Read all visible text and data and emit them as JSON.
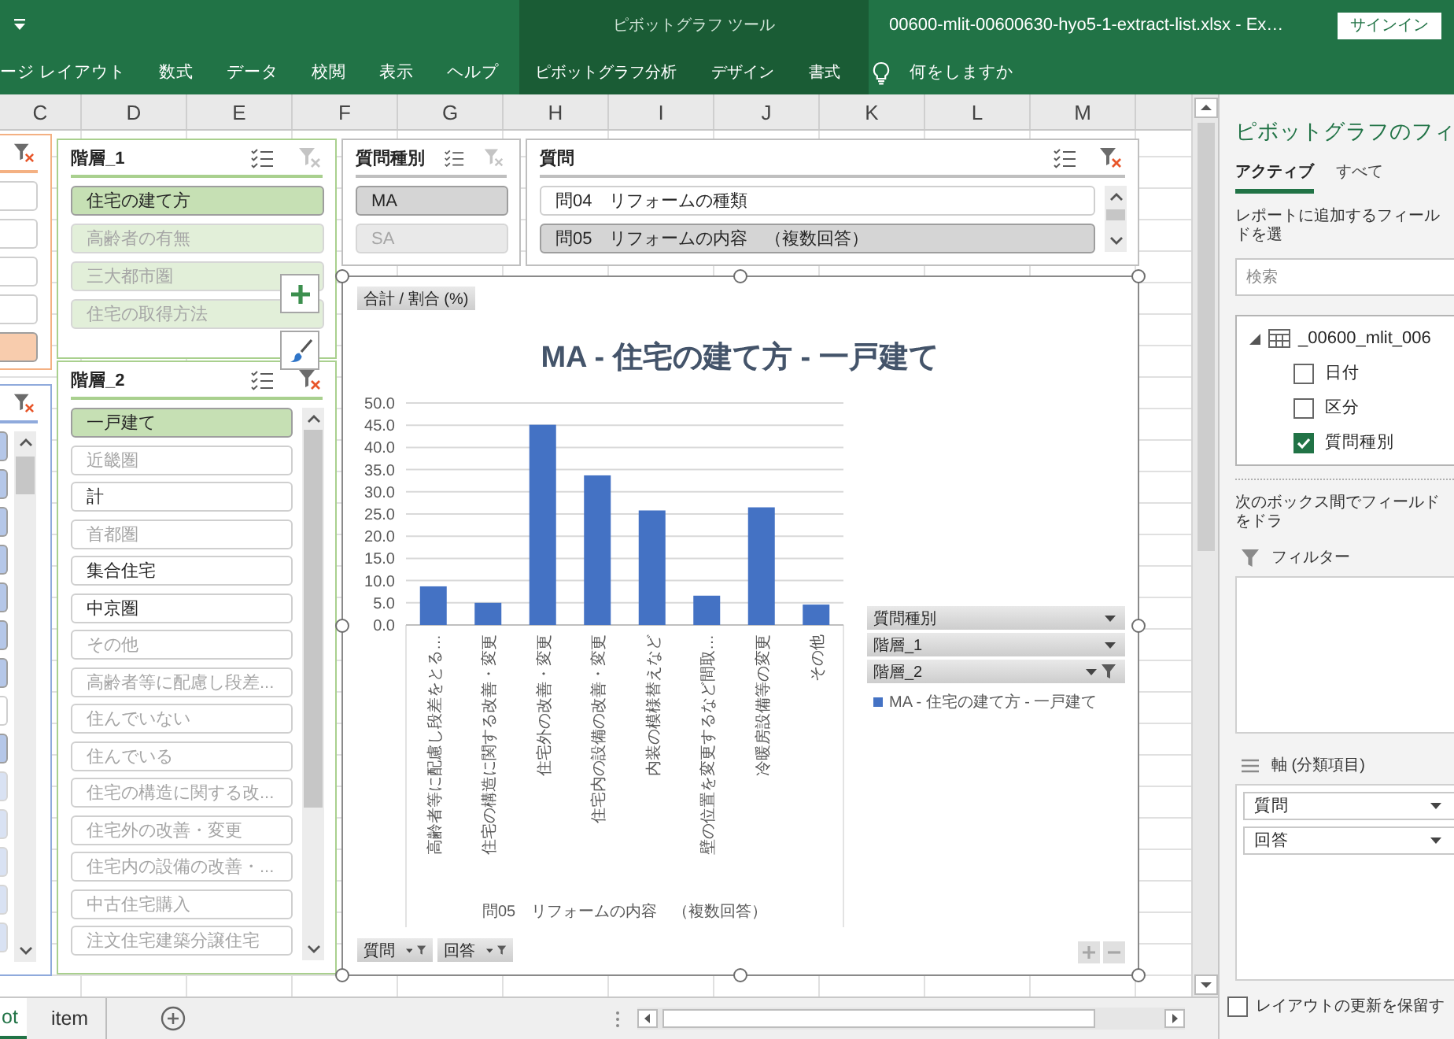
{
  "window": {
    "context_title": "ピボットグラフ ツール",
    "title": "00600-mlit-00600630-hyo5-1-extract-list.xlsx - Ex…",
    "sign_in": "サインイン"
  },
  "ribbon": {
    "tabs": [
      "ージ レイアウト",
      "数式",
      "データ",
      "校閲",
      "表示",
      "ヘルプ"
    ],
    "context_tabs": [
      "ピボットグラフ分析",
      "デザイン",
      "書式"
    ],
    "tell_me": "何をしますか"
  },
  "columns": [
    "C",
    "D",
    "E",
    "F",
    "G",
    "H",
    "I",
    "J",
    "K",
    "L",
    "M"
  ],
  "slicers": [
    {
      "color": "#f4b183",
      "filtered": true,
      "items": [
        {
          "selected": false
        },
        {
          "selected": false
        },
        {
          "selected": false
        },
        {
          "selected": false
        },
        {
          "selected": true,
          "has_data": true
        }
      ]
    },
    {
      "color": "#8faadc",
      "filtered": true,
      "scrollbar": true,
      "items": [
        {
          "selected": true,
          "has_data": true
        },
        {
          "selected": true,
          "has_data": true
        },
        {
          "selected": true,
          "has_data": true
        },
        {
          "selected": true,
          "has_data": true
        },
        {
          "selected": true,
          "has_data": true
        },
        {
          "selected": true,
          "has_data": true
        },
        {
          "selected": true,
          "has_data": true
        },
        {
          "selected": false
        },
        {
          "selected": true,
          "has_data": true
        },
        {
          "selected": true,
          "has_data": false
        },
        {
          "selected": true,
          "has_data": false
        },
        {
          "selected": true,
          "has_data": false
        },
        {
          "selected": true,
          "has_data": false
        },
        {
          "selected": true,
          "has_data": false
        }
      ]
    },
    {
      "title": "階層_1",
      "color": "#a9d08e",
      "filtered": false,
      "items": [
        {
          "label": "住宅の建て方",
          "selected": true,
          "has_data": true
        },
        {
          "label": "高齢者の有無",
          "selected": true,
          "has_data": false
        },
        {
          "label": "三大都市圏",
          "selected": true,
          "has_data": false
        },
        {
          "label": "住宅の取得方法",
          "selected": true,
          "has_data": false
        }
      ]
    },
    {
      "title": "階層_2",
      "color": "#a9d08e",
      "filtered": true,
      "scrollbar": true,
      "items": [
        {
          "label": "一戸建て",
          "selected": true,
          "has_data": true
        },
        {
          "label": "近畿圏",
          "selected": false,
          "has_data": false
        },
        {
          "label": "計",
          "selected": false,
          "has_data": true
        },
        {
          "label": "首都圏",
          "selected": false,
          "has_data": false
        },
        {
          "label": "集合住宅",
          "selected": false,
          "has_data": true
        },
        {
          "label": "中京圏",
          "selected": false,
          "has_data": true
        },
        {
          "label": "その他",
          "selected": false,
          "has_data": false
        },
        {
          "label": "高齢者等に配慮し段差...",
          "selected": false,
          "has_data": false
        },
        {
          "label": "住んでいない",
          "selected": false,
          "has_data": false
        },
        {
          "label": "住んでいる",
          "selected": false,
          "has_data": false
        },
        {
          "label": "住宅の構造に関する改...",
          "selected": false,
          "has_data": false
        },
        {
          "label": "住宅外の改善・変更",
          "selected": false,
          "has_data": false
        },
        {
          "label": "住宅内の設備の改善・...",
          "selected": false,
          "has_data": false
        },
        {
          "label": "中古住宅購入",
          "selected": false,
          "has_data": false
        },
        {
          "label": "注文住宅建築分譲住宅",
          "selected": false,
          "has_data": false
        }
      ]
    },
    {
      "title": "質問種別",
      "color": "#bfbfbf",
      "filtered": false,
      "items": [
        {
          "label": "MA",
          "selected": true,
          "has_data": true
        },
        {
          "label": "SA",
          "selected": true,
          "has_data": false
        }
      ]
    },
    {
      "title": "質問",
      "color": "#bfbfbf",
      "filtered": true,
      "scrollbar": true,
      "items": [
        {
          "label": "問04　リフォームの種類",
          "selected": false,
          "has_data": true
        },
        {
          "label": "問05　リフォームの内容　（複数回答）",
          "selected": true,
          "has_data": true
        }
      ]
    }
  ],
  "chart": {
    "value_button": "合計 / 割合 (%)",
    "chart_data": {
      "type": "bar",
      "title": "MA - 住宅の建て方 - 一戸建て",
      "xlabel": "問05　リフォームの内容　（複数回答）",
      "categories": [
        "高齢者等に配慮し段差をとる…",
        "住宅の構造に関する改善・変更",
        "住宅外の改善・変更",
        "住宅内の設備の改善・変更",
        "内装の模様替えなど",
        "壁の位置を変更するなど間取…",
        "冷暖房設備等の変更",
        "その他"
      ],
      "series": [
        {
          "name": "MA - 住宅の建て方 - 一戸建て",
          "color": "#4472c4",
          "values": [
            8.7,
            5.0,
            45.1,
            33.7,
            25.8,
            6.6,
            26.5,
            4.6
          ]
        }
      ],
      "ylim": [
        0,
        50
      ],
      "yticks": [
        {
          "value": 0,
          "label": "0.0"
        },
        {
          "value": 5,
          "label": "5.0"
        },
        {
          "value": 10,
          "label": "10.0"
        },
        {
          "value": 15,
          "label": "15.0"
        },
        {
          "value": 20,
          "label": "20.0"
        },
        {
          "value": 25,
          "label": "25.0"
        },
        {
          "value": 30,
          "label": "30.0"
        },
        {
          "value": 35,
          "label": "35.0"
        },
        {
          "value": 40,
          "label": "40.0"
        },
        {
          "value": 45,
          "label": "45.0"
        },
        {
          "value": 50,
          "label": "50.0"
        }
      ],
      "grid": true
    },
    "legend_buttons": [
      {
        "label": "質問種別",
        "filtered": false
      },
      {
        "label": "階層_1",
        "filtered": false
      },
      {
        "label": "階層_2",
        "filtered": true
      }
    ],
    "axis_buttons": [
      {
        "label": "質問",
        "filtered": true
      },
      {
        "label": "回答",
        "filtered": true
      }
    ]
  },
  "sheet_tabs": [
    {
      "label": "ot",
      "selected": true
    },
    {
      "label": "item",
      "selected": false
    }
  ],
  "field_pane": {
    "title": "ピボットグラフのフィ",
    "tabs": [
      {
        "label": "アクティブ",
        "selected": true
      },
      {
        "label": "すべて",
        "selected": false
      }
    ],
    "instruction": "レポートに追加するフィールドを選",
    "search": {
      "placeholder": "検索"
    },
    "fields": [
      {
        "label": "_00600_mlit_006",
        "expanded": true,
        "children": [
          {
            "label": "日付",
            "checked": false
          },
          {
            "label": "区分",
            "checked": false
          },
          {
            "label": "質問種別",
            "checked": true
          }
        ]
      }
    ],
    "areas_hint": "次のボックス間でフィールドをドラ",
    "areas": [
      {
        "kind": "filter",
        "title": "フィルター"
      },
      {
        "kind": "axis",
        "title": "軸 (分類項目)",
        "items": [
          "質問",
          "回答"
        ]
      }
    ],
    "defer_update": {
      "label": "レイアウトの更新を保留す",
      "checked": false
    }
  }
}
